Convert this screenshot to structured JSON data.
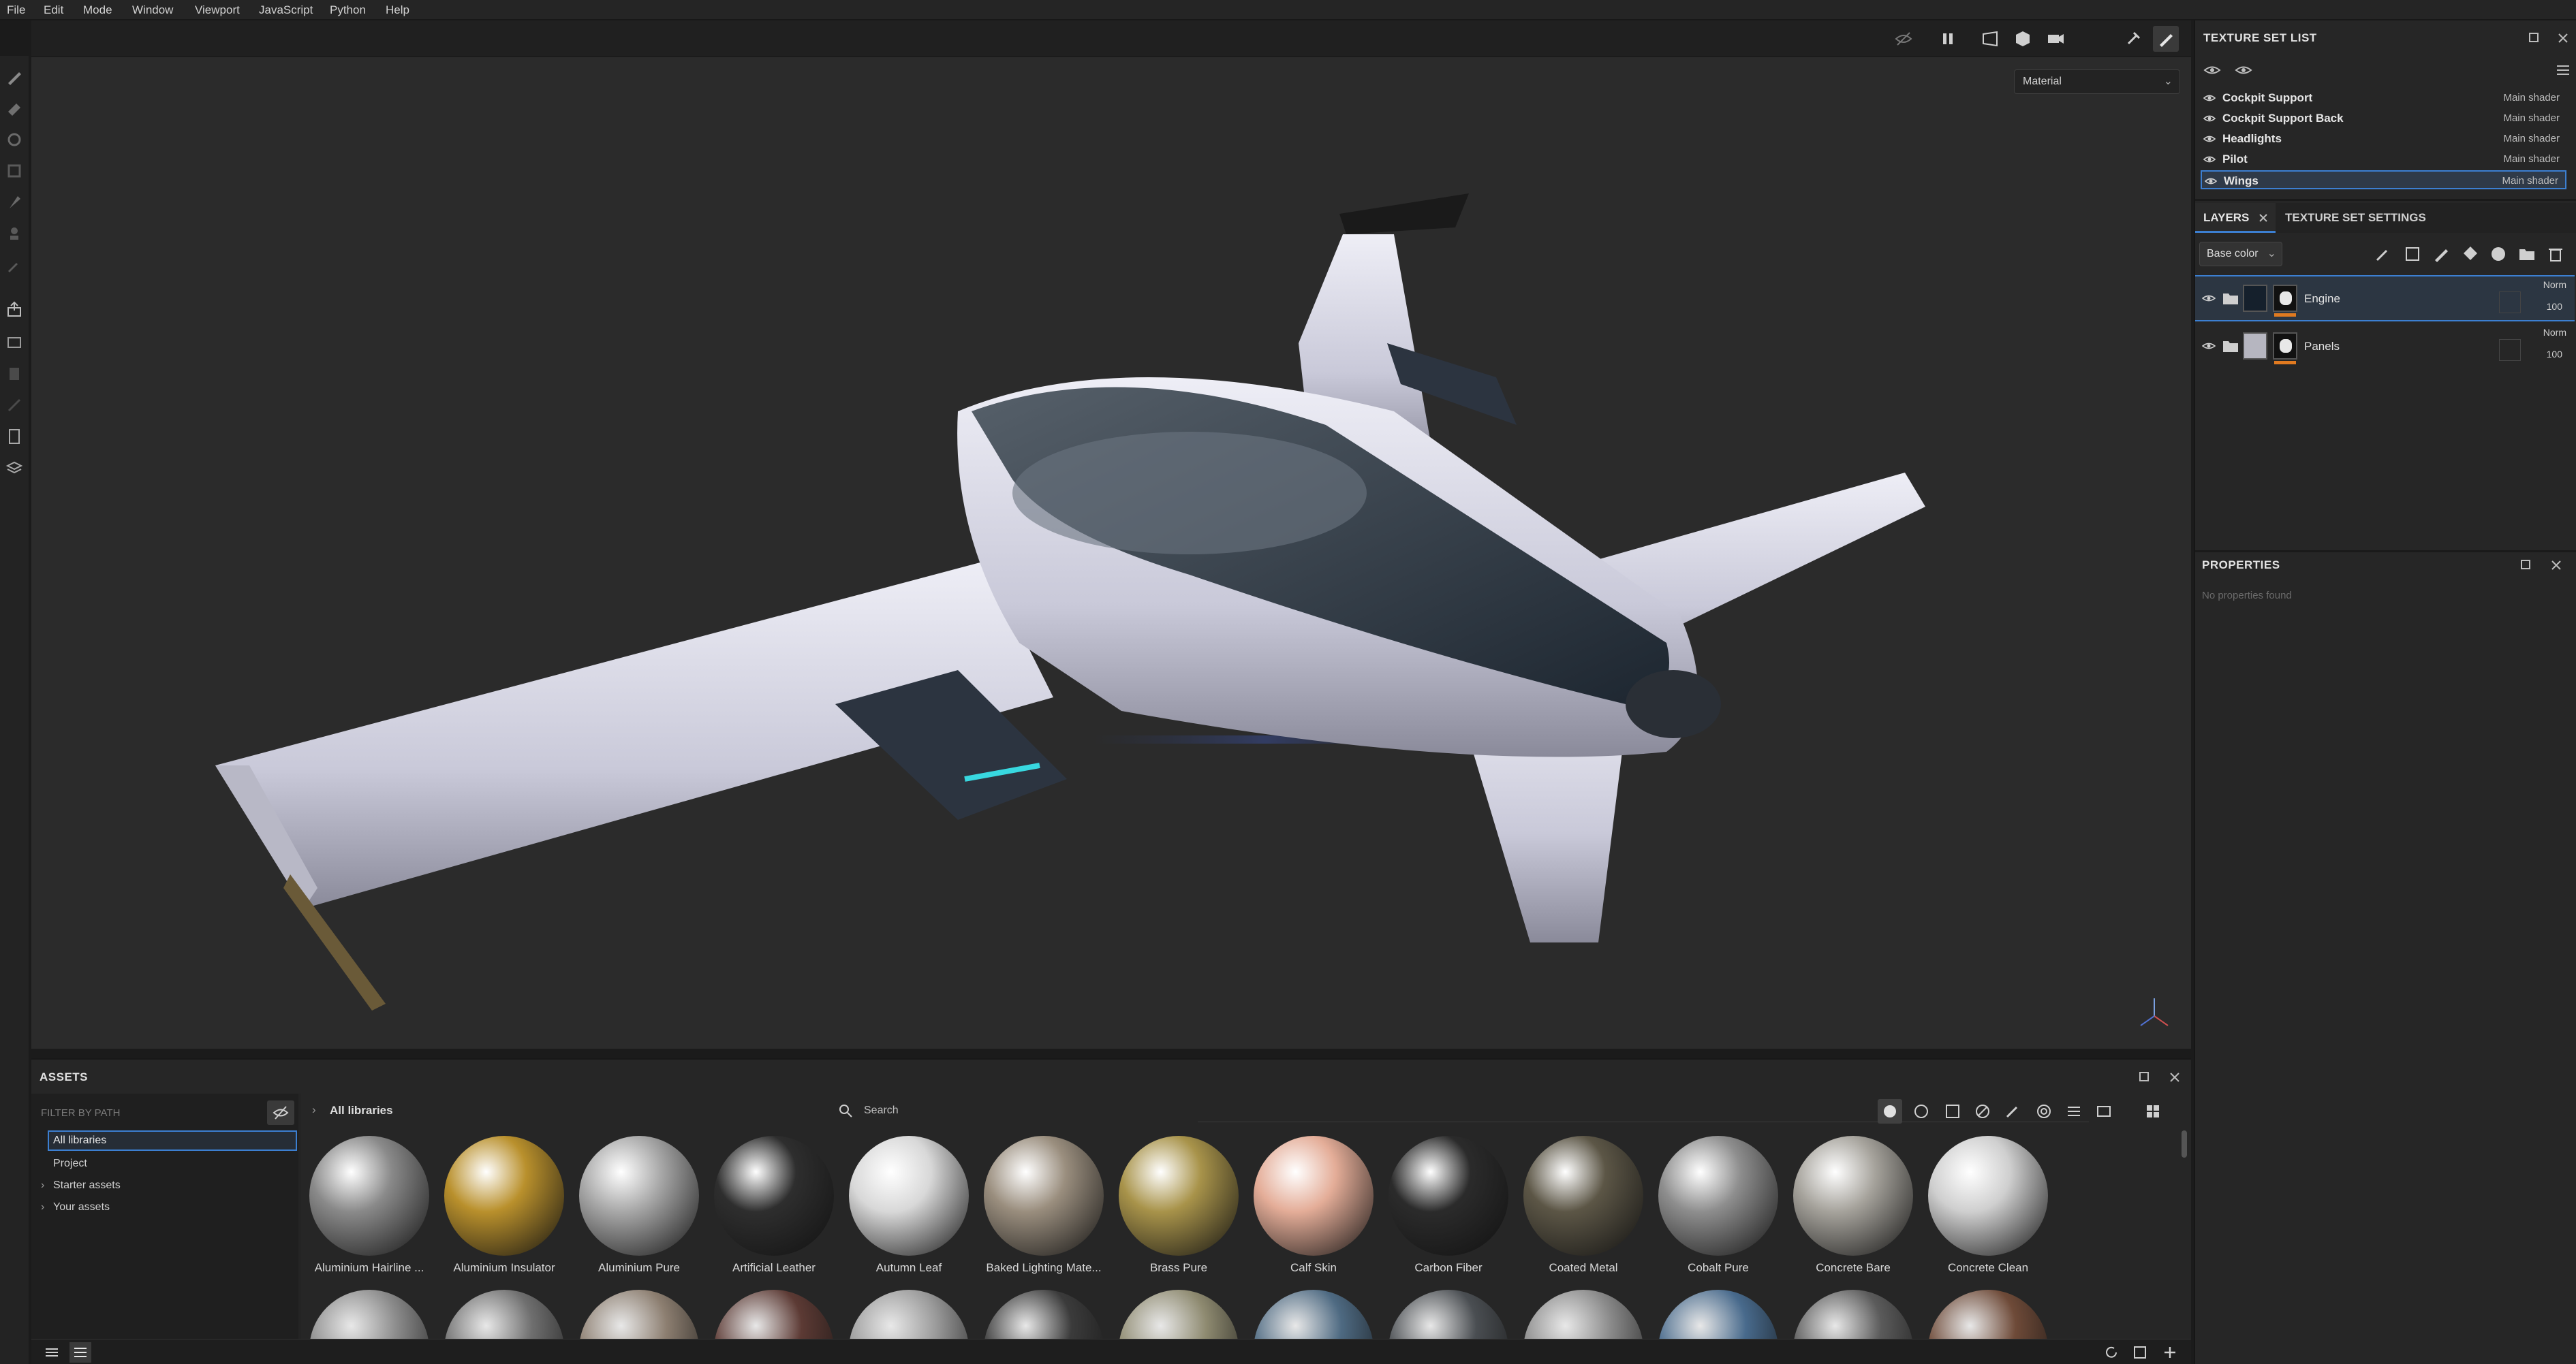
{
  "menu": [
    "File",
    "Edit",
    "Mode",
    "Window",
    "Viewport",
    "JavaScript",
    "Python",
    "Help"
  ],
  "viewport": {
    "material_select": "Material",
    "icons": [
      "hide-icon",
      "pause-icon",
      "perspective-icon",
      "cube-icon",
      "camera-icon",
      "tools-icon",
      "paint-icon",
      "screenshot-icon"
    ]
  },
  "texture_set_list": {
    "title": "TEXTURE SET LIST",
    "items": [
      {
        "name": "Cockpit Support",
        "shader": "Main shader"
      },
      {
        "name": "Cockpit Support Back",
        "shader": "Main shader"
      },
      {
        "name": "Headlights",
        "shader": "Main shader"
      },
      {
        "name": "Pilot",
        "shader": "Main shader"
      },
      {
        "name": "Wings",
        "shader": "Main shader"
      }
    ]
  },
  "layers": {
    "tab_layers": "LAYERS",
    "tab_settings": "TEXTURE SET SETTINGS",
    "channel": "Base color",
    "rows": [
      {
        "name": "Engine",
        "blend": "Norm",
        "opacity": "100"
      },
      {
        "name": "Panels",
        "blend": "Norm",
        "opacity": "100"
      }
    ]
  },
  "properties": {
    "title": "PROPERTIES",
    "empty": "No properties found"
  },
  "assets": {
    "title": "ASSETS",
    "filter_placeholder": "FILTER BY PATH",
    "breadcrumb": "All libraries",
    "search_placeholder": "Search",
    "tree": [
      "All libraries",
      "Project",
      "Starter assets",
      "Your assets"
    ],
    "materials": [
      {
        "name": "Aluminium Hairline ...",
        "color": "#8a8a8a"
      },
      {
        "name": "Aluminium Insulator",
        "color": "#b9902c"
      },
      {
        "name": "Aluminium Pure",
        "color": "#a8a8a8"
      },
      {
        "name": "Artificial Leather",
        "color": "#2e2e2e"
      },
      {
        "name": "Autumn Leaf",
        "color": "#d8d8d8"
      },
      {
        "name": "Baked Lighting Mate...",
        "color": "#9a8e7e"
      },
      {
        "name": "Brass Pure",
        "color": "#a8934a"
      },
      {
        "name": "Calf Skin",
        "color": "#e4ad98"
      },
      {
        "name": "Carbon Fiber",
        "color": "#2b2b2b"
      },
      {
        "name": "Coated Metal",
        "color": "#5c5646"
      },
      {
        "name": "Cobalt Pure",
        "color": "#8e8e8e"
      },
      {
        "name": "Concrete Bare",
        "color": "#a6a39c"
      },
      {
        "name": "Concrete Clean",
        "color": "#cfcfcf"
      }
    ],
    "row2_colors": [
      "#8b8b8b",
      "#6f6f6f",
      "#8c7e70",
      "#5c3a34",
      "#9a9a9a",
      "#3b3b3b",
      "#8e8a70",
      "#4e6a82",
      "#4a4e52",
      "#8a8a8a",
      "#486a8c",
      "#5b5b5b",
      "#6e4a38"
    ]
  }
}
